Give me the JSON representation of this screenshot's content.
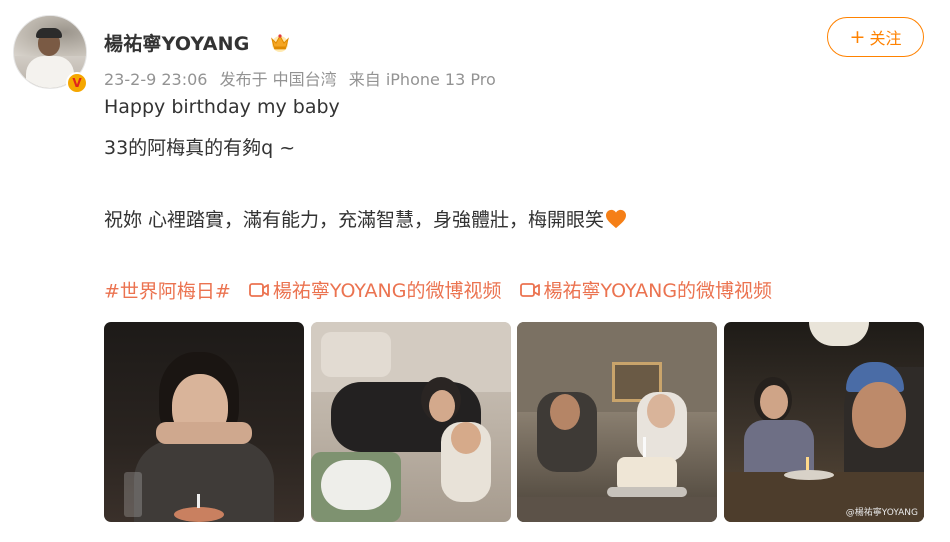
{
  "post": {
    "username": "楊祐寧YOYANG",
    "verified_mark": "V",
    "meta": {
      "datetime": "23-2-9 23:06",
      "location": "发布于 中国台湾",
      "source": "来自 iPhone 13 Pro"
    },
    "follow_button": {
      "plus": "+",
      "label": "关注"
    },
    "text": {
      "line1": "Happy birthday my baby",
      "line2": "33的阿梅真的有夠q ~",
      "line3": "祝妳 心裡踏實，滿有能力，充滿智慧，身強體壯，梅開眼笑"
    },
    "links": {
      "hashtag": "#世界阿梅日#",
      "video1": "楊祐寧YOYANG的微博视频",
      "video2": "楊祐寧YOYANG的微博视频"
    },
    "photos": [
      {
        "name": "photo-1"
      },
      {
        "name": "photo-2"
      },
      {
        "name": "photo-3"
      },
      {
        "name": "photo-4",
        "watermark": "@楊祐寧YOYANG"
      }
    ]
  },
  "colors": {
    "accent": "#ff8200",
    "link": "#eb7350",
    "meta": "#939393",
    "text": "#333333"
  },
  "icons": {
    "crown": "crown-icon",
    "heart": "orange-heart-icon",
    "video": "video-camera-icon",
    "verified": "verified-badge-icon"
  }
}
